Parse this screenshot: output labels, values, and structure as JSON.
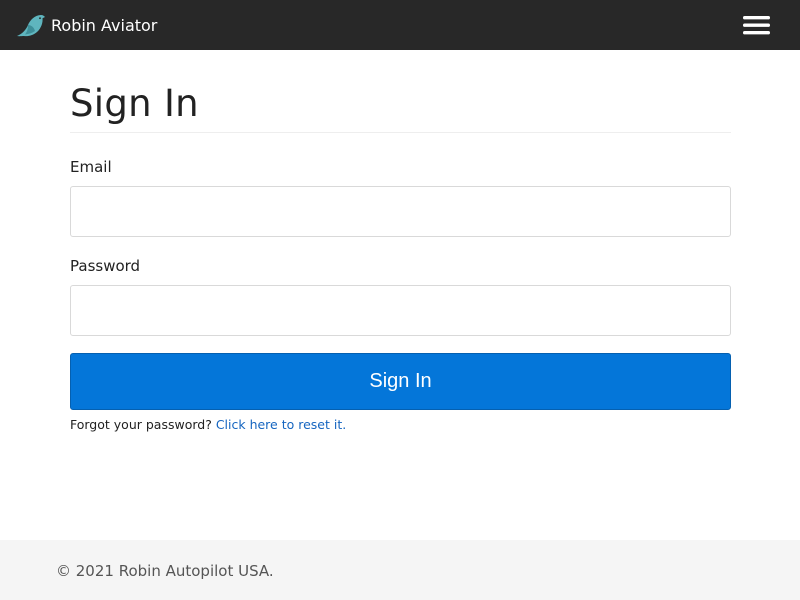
{
  "navbar": {
    "brand_name": "Robin Aviator",
    "logo_icon": "robin-bird-icon",
    "menu_icon": "hamburger-menu-icon",
    "background_color": "#282828",
    "logo_color": "#5fb5be"
  },
  "form": {
    "title": "Sign In",
    "email_label": "Email",
    "email_value": "",
    "password_label": "Password",
    "password_value": "",
    "submit_label": "Sign In",
    "forgot_text": "Forgot your password?",
    "reset_link": "Click here to reset it",
    "reset_suffix": ".",
    "accent_color": "#0476d9"
  },
  "footer": {
    "text": "© 2021 Robin Autopilot USA."
  }
}
